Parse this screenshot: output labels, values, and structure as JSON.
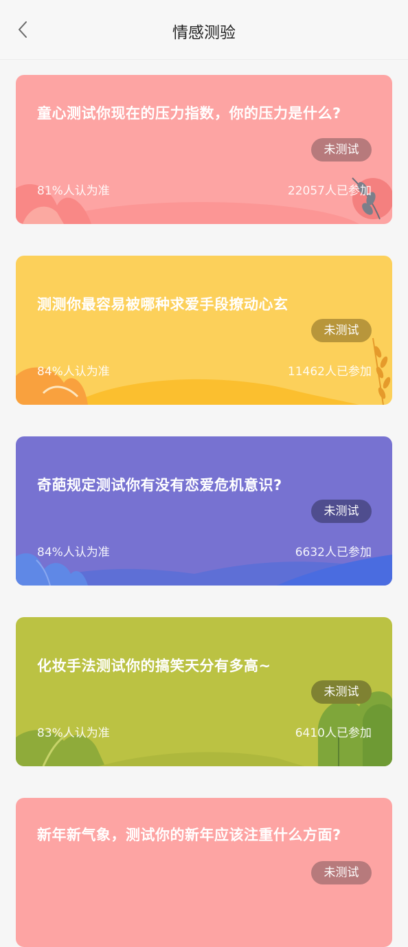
{
  "header": {
    "title": "情感测验",
    "back_icon": "chevron-left-icon"
  },
  "cards": [
    {
      "title": "童心测试你现在的压力指数，你的压力是什么?",
      "badge": "未测试",
      "accuracy": "81%人认为准",
      "participants": "22057人已参加",
      "color": "#fda4a3"
    },
    {
      "title": "测测你最容易被哪种求爱手段撩动心玄",
      "badge": "未测试",
      "accuracy": "84%人认为准",
      "participants": "11462人已参加",
      "color": "#fcd05a"
    },
    {
      "title": "奇葩规定测试你有没有恋爱危机意识?",
      "badge": "未测试",
      "accuracy": "84%人认为准",
      "participants": "6632人已参加",
      "color": "#7772d1"
    },
    {
      "title": "化妆手法测试你的搞笑天分有多高~",
      "badge": "未测试",
      "accuracy": "83%人认为准",
      "participants": "6410人已参加",
      "color": "#bbc243"
    },
    {
      "title": "新年新气象，测试你的新年应该注重什么方面?",
      "badge": "未测试",
      "accuracy": "",
      "participants": "",
      "color": "#fda4a3"
    }
  ]
}
